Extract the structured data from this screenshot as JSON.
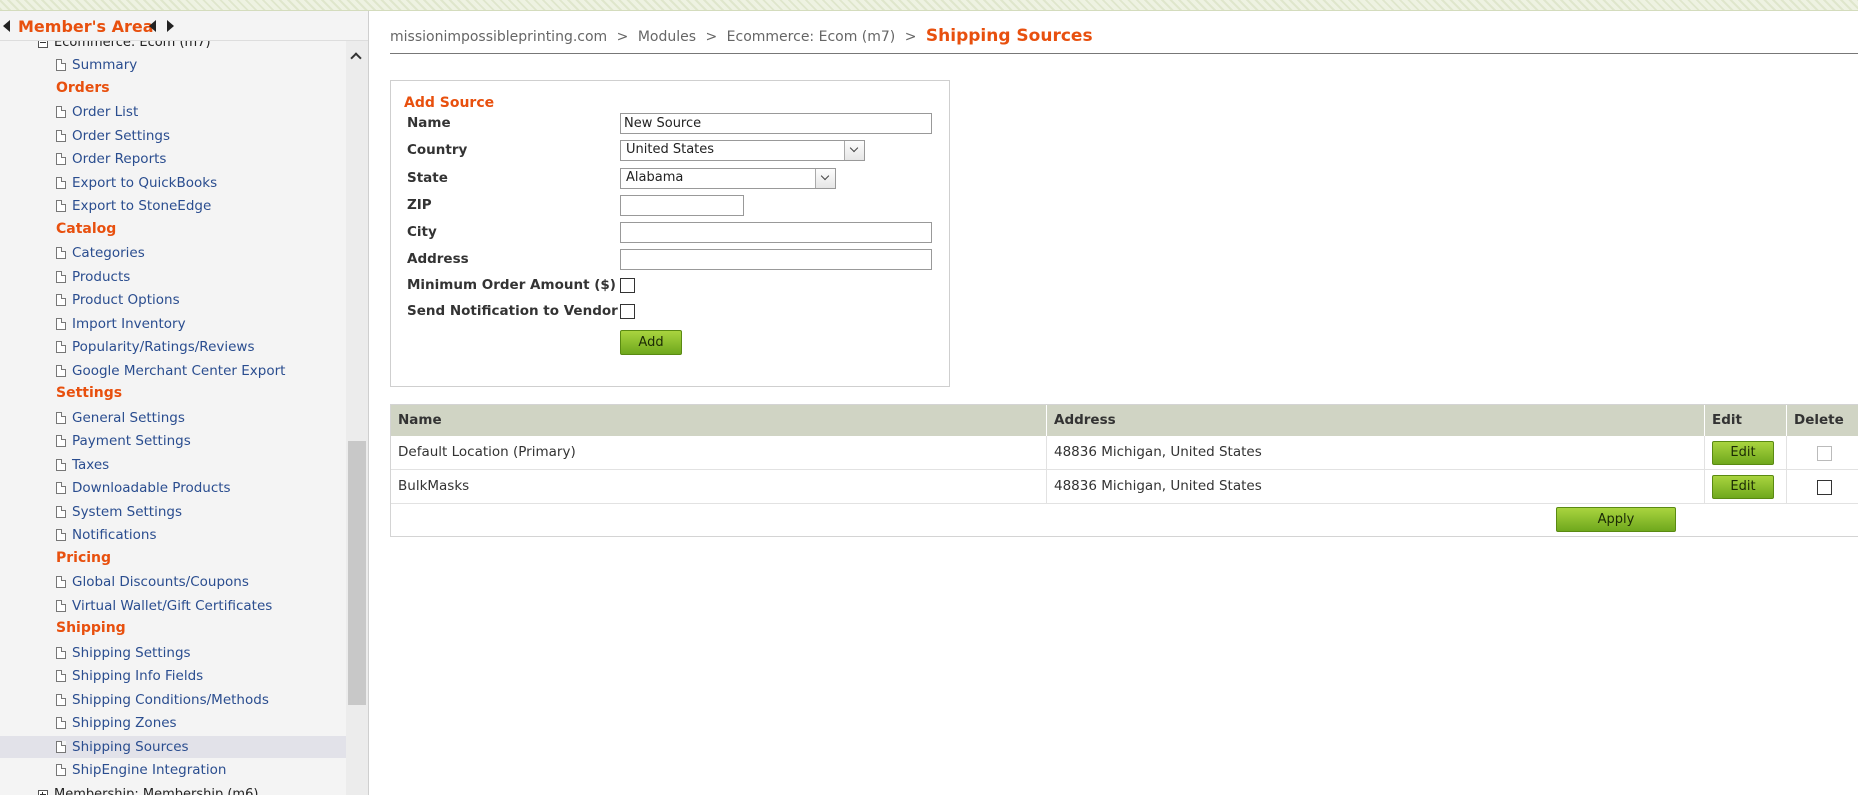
{
  "sidebar": {
    "title": "Member's Area",
    "tree_root": "Ecommerce: Ecom (m7)",
    "tree_next": "Membership: Membership (m6)",
    "items": [
      {
        "type": "item",
        "label": "Summary"
      },
      {
        "type": "group",
        "label": "Orders"
      },
      {
        "type": "item",
        "label": "Order List"
      },
      {
        "type": "item",
        "label": "Order Settings"
      },
      {
        "type": "item",
        "label": "Order Reports"
      },
      {
        "type": "item",
        "label": "Export to QuickBooks"
      },
      {
        "type": "item",
        "label": "Export to StoneEdge"
      },
      {
        "type": "group",
        "label": "Catalog"
      },
      {
        "type": "item",
        "label": "Categories"
      },
      {
        "type": "item",
        "label": "Products"
      },
      {
        "type": "item",
        "label": "Product Options"
      },
      {
        "type": "item",
        "label": "Import Inventory"
      },
      {
        "type": "item",
        "label": "Popularity/Ratings/Reviews"
      },
      {
        "type": "item",
        "label": "Google Merchant Center Export"
      },
      {
        "type": "group",
        "label": "Settings"
      },
      {
        "type": "item",
        "label": "General Settings"
      },
      {
        "type": "item",
        "label": "Payment Settings"
      },
      {
        "type": "item",
        "label": "Taxes"
      },
      {
        "type": "item",
        "label": "Downloadable Products"
      },
      {
        "type": "item",
        "label": "System Settings"
      },
      {
        "type": "item",
        "label": "Notifications"
      },
      {
        "type": "group",
        "label": "Pricing"
      },
      {
        "type": "item",
        "label": "Global Discounts/Coupons"
      },
      {
        "type": "item",
        "label": "Virtual Wallet/Gift Certificates"
      },
      {
        "type": "group",
        "label": "Shipping"
      },
      {
        "type": "item",
        "label": "Shipping Settings"
      },
      {
        "type": "item",
        "label": "Shipping Info Fields"
      },
      {
        "type": "item",
        "label": "Shipping Conditions/Methods"
      },
      {
        "type": "item",
        "label": "Shipping Zones"
      },
      {
        "type": "item",
        "label": "Shipping Sources",
        "selected": true
      },
      {
        "type": "item",
        "label": "ShipEngine Integration"
      }
    ]
  },
  "breadcrumb": {
    "site": "missionimpossibleprinting.com",
    "modules": "Modules",
    "module": "Ecommerce: Ecom (m7)",
    "sep": ">",
    "current": "Shipping Sources"
  },
  "add_source": {
    "title": "Add Source",
    "name_label": "Name",
    "name_value": "New Source",
    "country_label": "Country",
    "country_value": "United States",
    "state_label": "State",
    "state_value": "Alabama",
    "zip_label": "ZIP",
    "zip_value": "",
    "city_label": "City",
    "city_value": "",
    "address_label": "Address",
    "address_value": "",
    "min_order_label": "Minimum Order Amount ($)",
    "notify_label": "Send Notification to Vendor",
    "add_button": "Add"
  },
  "sources_table": {
    "headers": {
      "name": "Name",
      "address": "Address",
      "edit": "Edit",
      "delete": "Delete"
    },
    "rows": [
      {
        "name": "Default Location (Primary)",
        "address": "48836 Michigan, United States",
        "edit": "Edit",
        "delete_enabled": false
      },
      {
        "name": "BulkMasks",
        "address": "48836 Michigan, United States",
        "edit": "Edit",
        "delete_enabled": true
      }
    ],
    "apply_button": "Apply"
  },
  "colors": {
    "accent_orange": "#e8500e",
    "link_blue": "#2a4d8f",
    "button_green": "#8cc031",
    "table_header": "#d0d4c4"
  }
}
